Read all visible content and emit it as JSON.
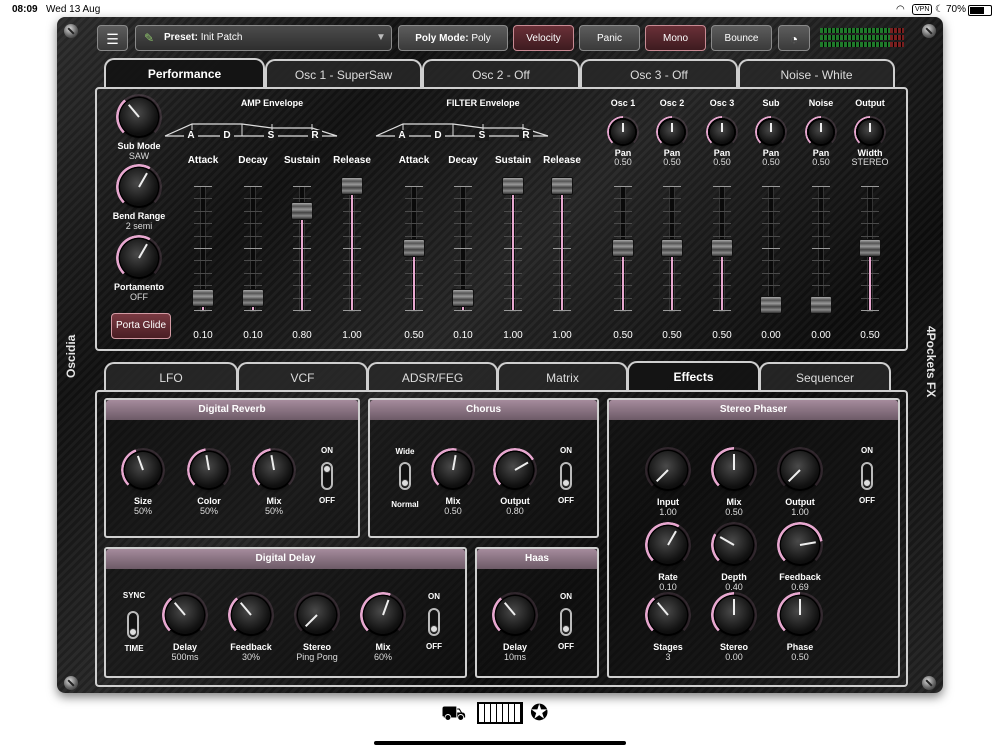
{
  "status_bar": {
    "time": "08:09",
    "date": "Wed 13 Aug",
    "battery": "70%",
    "vpn": "VPN",
    "battery_level": 0.7
  },
  "brand": {
    "left": "Oscidia",
    "right": "4Pockets FX"
  },
  "toolbar": {
    "preset_label": "Preset:",
    "preset_value": "Init Patch",
    "poly_mode_label": "Poly Mode:",
    "poly_mode_value": "Poly",
    "velocity": "Velocity",
    "panic": "Panic",
    "mono": "Mono",
    "bounce": "Bounce"
  },
  "top_tabs": [
    "Performance",
    "Osc 1 - SuperSaw",
    "Osc 2 - Off",
    "Osc 3 - Off",
    "Noise - White"
  ],
  "performance": {
    "left_knobs": [
      {
        "label": "Sub Mode",
        "value": "SAW"
      },
      {
        "label": "Bend Range",
        "value": "2 semi"
      },
      {
        "label": "Portamento",
        "value": "OFF"
      }
    ],
    "porta_glide": "Porta Glide",
    "amp_env_title": "AMP Envelope",
    "filter_env_title": "FILTER Envelope",
    "env_letters": [
      "A",
      "D",
      "S",
      "R"
    ],
    "fader_labels": [
      "Attack",
      "Decay",
      "Sustain",
      "Release"
    ],
    "amp_values": [
      "0.10",
      "0.10",
      "0.80",
      "1.00"
    ],
    "filter_values": [
      "0.50",
      "0.10",
      "1.00",
      "1.00"
    ],
    "mixer": [
      {
        "title": "Osc 1",
        "knob": "Pan",
        "knob_value": "0.50",
        "fader": "0.50"
      },
      {
        "title": "Osc 2",
        "knob": "Pan",
        "knob_value": "0.50",
        "fader": "0.50"
      },
      {
        "title": "Osc 3",
        "knob": "Pan",
        "knob_value": "0.50",
        "fader": "0.50"
      },
      {
        "title": "Sub",
        "knob": "Pan",
        "knob_value": "0.50",
        "fader": "0.00"
      },
      {
        "title": "Noise",
        "knob": "Pan",
        "knob_value": "0.50",
        "fader": "0.00"
      },
      {
        "title": "Output",
        "knob": "Width",
        "knob_value": "STEREO",
        "fader": "0.50"
      }
    ]
  },
  "bottom_tabs": [
    "LFO",
    "VCF",
    "ADSR/FEG",
    "Matrix",
    "Effects",
    "Sequencer"
  ],
  "effects": {
    "reverb": {
      "title": "Digital Reverb",
      "knobs": [
        {
          "label": "Size",
          "value": "50%"
        },
        {
          "label": "Color",
          "value": "50%"
        },
        {
          "label": "Mix",
          "value": "50%"
        }
      ],
      "on": "ON",
      "off": "OFF"
    },
    "chorus": {
      "title": "Chorus",
      "wide": "Wide",
      "normal": "Normal",
      "knobs": [
        {
          "label": "Mix",
          "value": "0.50"
        },
        {
          "label": "Output",
          "value": "0.80"
        }
      ],
      "on": "ON",
      "off": "OFF"
    },
    "phaser": {
      "title": "Stereo Phaser",
      "knobs": [
        {
          "label": "Input",
          "value": "1.00"
        },
        {
          "label": "Mix",
          "value": "0.50"
        },
        {
          "label": "Output",
          "value": "1.00"
        },
        {
          "label": "Rate",
          "value": "0.10"
        },
        {
          "label": "Depth",
          "value": "0.40"
        },
        {
          "label": "Feedback",
          "value": "0.69"
        },
        {
          "label": "Stages",
          "value": "3"
        },
        {
          "label": "Stereo",
          "value": "0.00"
        },
        {
          "label": "Phase",
          "value": "0.50"
        }
      ],
      "on": "ON",
      "off": "OFF"
    },
    "delay": {
      "title": "Digital Delay",
      "sync": "SYNC",
      "time": "TIME",
      "knobs": [
        {
          "label": "Delay",
          "value": "500ms"
        },
        {
          "label": "Feedback",
          "value": "30%"
        },
        {
          "label": "Stereo",
          "value": "Ping Pong"
        },
        {
          "label": "Mix",
          "value": "60%"
        }
      ],
      "on": "ON",
      "off": "OFF"
    },
    "haas": {
      "title": "Haas",
      "knobs": [
        {
          "label": "Delay",
          "value": "10ms"
        }
      ],
      "on": "ON",
      "off": "OFF"
    }
  },
  "colors": {
    "accent_pink": "#e8a8d0",
    "section_header": "#8a7482",
    "red_button": "#6a3038"
  },
  "icons": [
    "menu-icon",
    "preset-icon",
    "dropdown-arrow-icon",
    "gauge-icon",
    "preset-library-icon",
    "keyboard-icon",
    "palette-icon"
  ]
}
